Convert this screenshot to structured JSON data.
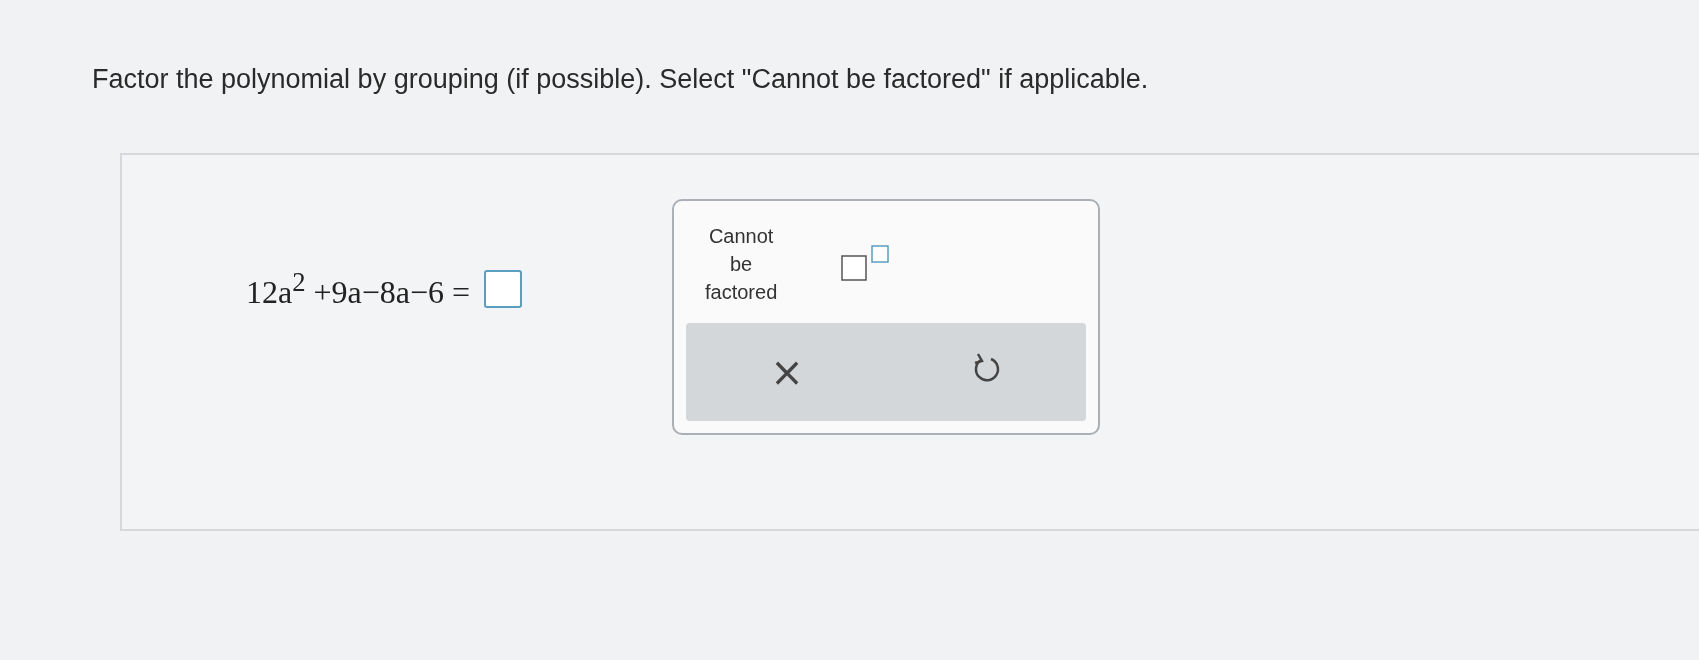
{
  "question": "Factor the polynomial by grouping (if possible). Select \"Cannot be factored\" if applicable.",
  "expression": "12a$^{2}$ +9a−8a−6 =",
  "keypad": {
    "keys": [
      {
        "kind": "text",
        "label": "Cannot be factored"
      },
      {
        "kind": "exponent"
      }
    ],
    "actions": [
      {
        "kind": "clear",
        "label": "×"
      },
      {
        "kind": "undo"
      }
    ]
  }
}
